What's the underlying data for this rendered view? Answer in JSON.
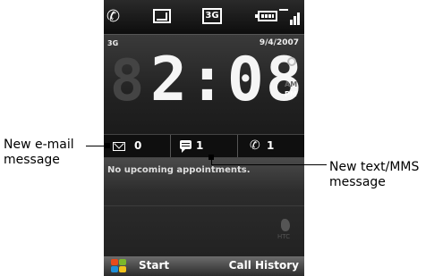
{
  "status_bar": {
    "network": "3G",
    "icons": [
      "missed-call-icon",
      "new-message-icon",
      "3g-icon",
      "battery-icon",
      "signal-icon"
    ]
  },
  "clock": {
    "network_label": "3G",
    "date": "9/4/2007",
    "time": "2:08",
    "am": "AM",
    "pm": "PM",
    "ghost_digit": "8"
  },
  "tabs": [
    {
      "icon": "alarm-icon",
      "selected": true
    },
    {
      "icon": "settings-icon",
      "selected": false
    },
    {
      "icon": "contacts-icon",
      "selected": false
    }
  ],
  "notifications": {
    "email_count": "0",
    "text_count": "1",
    "missed_calls_count": "1"
  },
  "appointments": {
    "message": "No upcoming appointments."
  },
  "brand": {
    "watermark": "HTC"
  },
  "softkeys": {
    "left": "Start",
    "right": "Call History"
  },
  "callouts": {
    "email": "New e-mail message",
    "text": "New text/MMS message"
  },
  "colors": {
    "selected_tab": "#7d7d7d",
    "background": "#1a1a1a",
    "text": "#ffffff"
  }
}
